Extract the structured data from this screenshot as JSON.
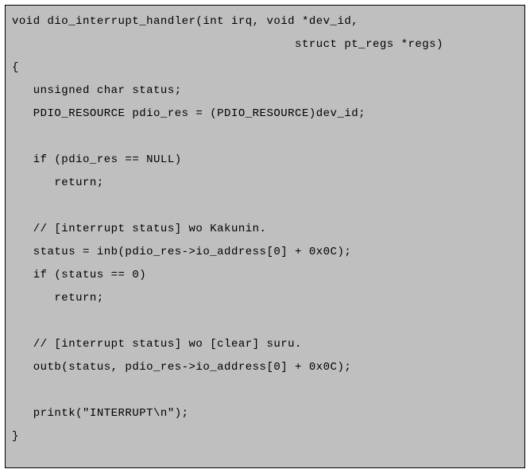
{
  "code": {
    "lines": [
      "void dio_interrupt_handler(int irq, void *dev_id,",
      "                                        struct pt_regs *regs)",
      "{",
      "   unsigned char status;",
      "   PDIO_RESOURCE pdio_res = (PDIO_RESOURCE)dev_id;",
      "",
      "   if (pdio_res == NULL)",
      "      return;",
      "",
      "   // [interrupt status] wo Kakunin.",
      "   status = inb(pdio_res->io_address[0] + 0x0C);",
      "   if (status == 0)",
      "      return;",
      "",
      "   // [interrupt status] wo [clear] suru.",
      "   outb(status, pdio_res->io_address[0] + 0x0C);",
      "",
      "   printk(\"INTERRUPT\\n\");",
      "}"
    ]
  }
}
